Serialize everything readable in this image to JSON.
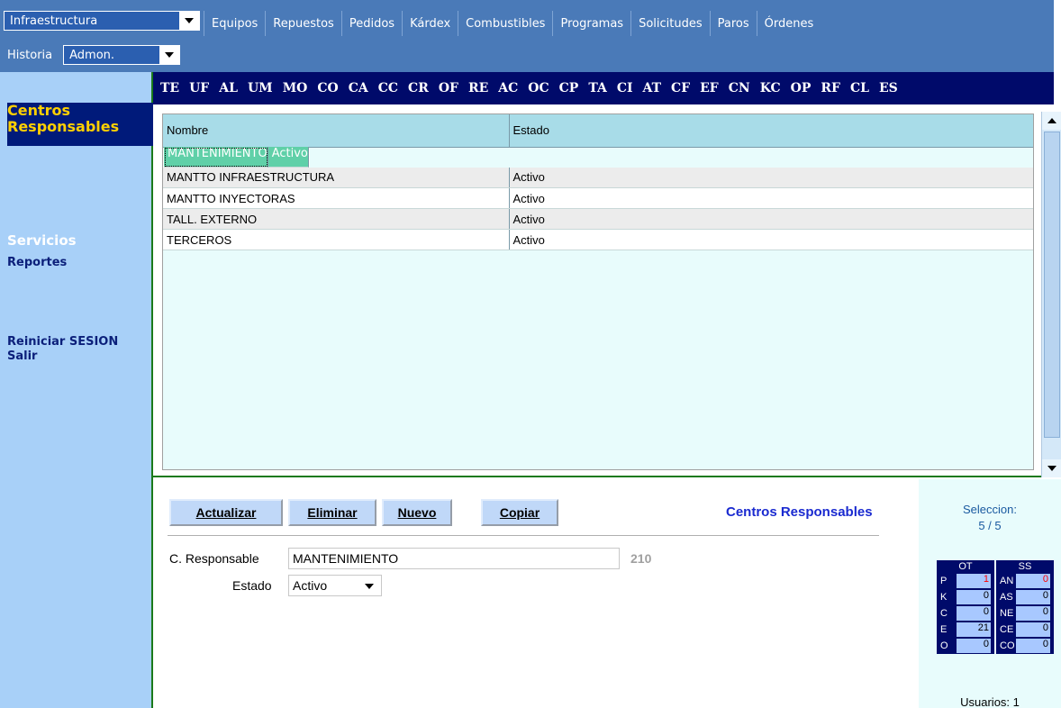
{
  "nav": {
    "module_select": "Infraestructura",
    "items": [
      "Equipos",
      "Repuestos",
      "Pedidos",
      "Kárdex",
      "Combustibles",
      "Programas",
      "Solicitudes",
      "Paros",
      "Órdenes"
    ],
    "historia": "Historia",
    "admin_select": "Admon."
  },
  "sidebar": {
    "title": "Centros Responsables",
    "services": "Servicios",
    "reportes": "Reportes",
    "reiniciar": "Reiniciar SESION",
    "salir": "Salir"
  },
  "codes": [
    "TE",
    "UF",
    "AL",
    "UM",
    "MO",
    "CO",
    "CA",
    "CC",
    "CR",
    "OF",
    "RE",
    "AC",
    "OC",
    "CP",
    "TA",
    "CI",
    "AT",
    "CF",
    "EF",
    "CN",
    "KC",
    "OP",
    "RF",
    "CL",
    "ES"
  ],
  "grid": {
    "columns": [
      "Nombre",
      "Estado"
    ],
    "rows": [
      [
        "MANTENIMIENTO",
        "Activo"
      ],
      [
        "MANTTO INFRAESTRUCTURA",
        "Activo"
      ],
      [
        "MANTTO INYECTORAS",
        "Activo"
      ],
      [
        "TALL. EXTERNO",
        "Activo"
      ],
      [
        "TERCEROS",
        "Activo"
      ]
    ],
    "selected_index": 0
  },
  "form": {
    "btn_update": "Actualizar",
    "btn_delete": "Eliminar",
    "btn_new": "Nuevo",
    "btn_copy": "Copiar",
    "title": "Centros Responsables",
    "label_cr": "C. Responsable",
    "value_cr": "MANTENIMIENTO",
    "cr_id": "210",
    "label_estado": "Estado",
    "value_estado": "Activo"
  },
  "panel": {
    "seleccion_label": "Seleccion:",
    "seleccion_value": "5 / 5",
    "ot_title": "OT",
    "ss_title": "SS",
    "ot": [
      [
        "P",
        "1"
      ],
      [
        "K",
        "0"
      ],
      [
        "C",
        "0"
      ],
      [
        "E",
        "21"
      ],
      [
        "O",
        "0"
      ]
    ],
    "ss": [
      [
        "AN",
        "0"
      ],
      [
        "AS",
        "0"
      ],
      [
        "NE",
        "0"
      ],
      [
        "CE",
        "0"
      ],
      [
        "CO",
        "0"
      ]
    ],
    "users": "Usuarios: 1"
  },
  "colors": {
    "alert_value": "#ff0000"
  }
}
